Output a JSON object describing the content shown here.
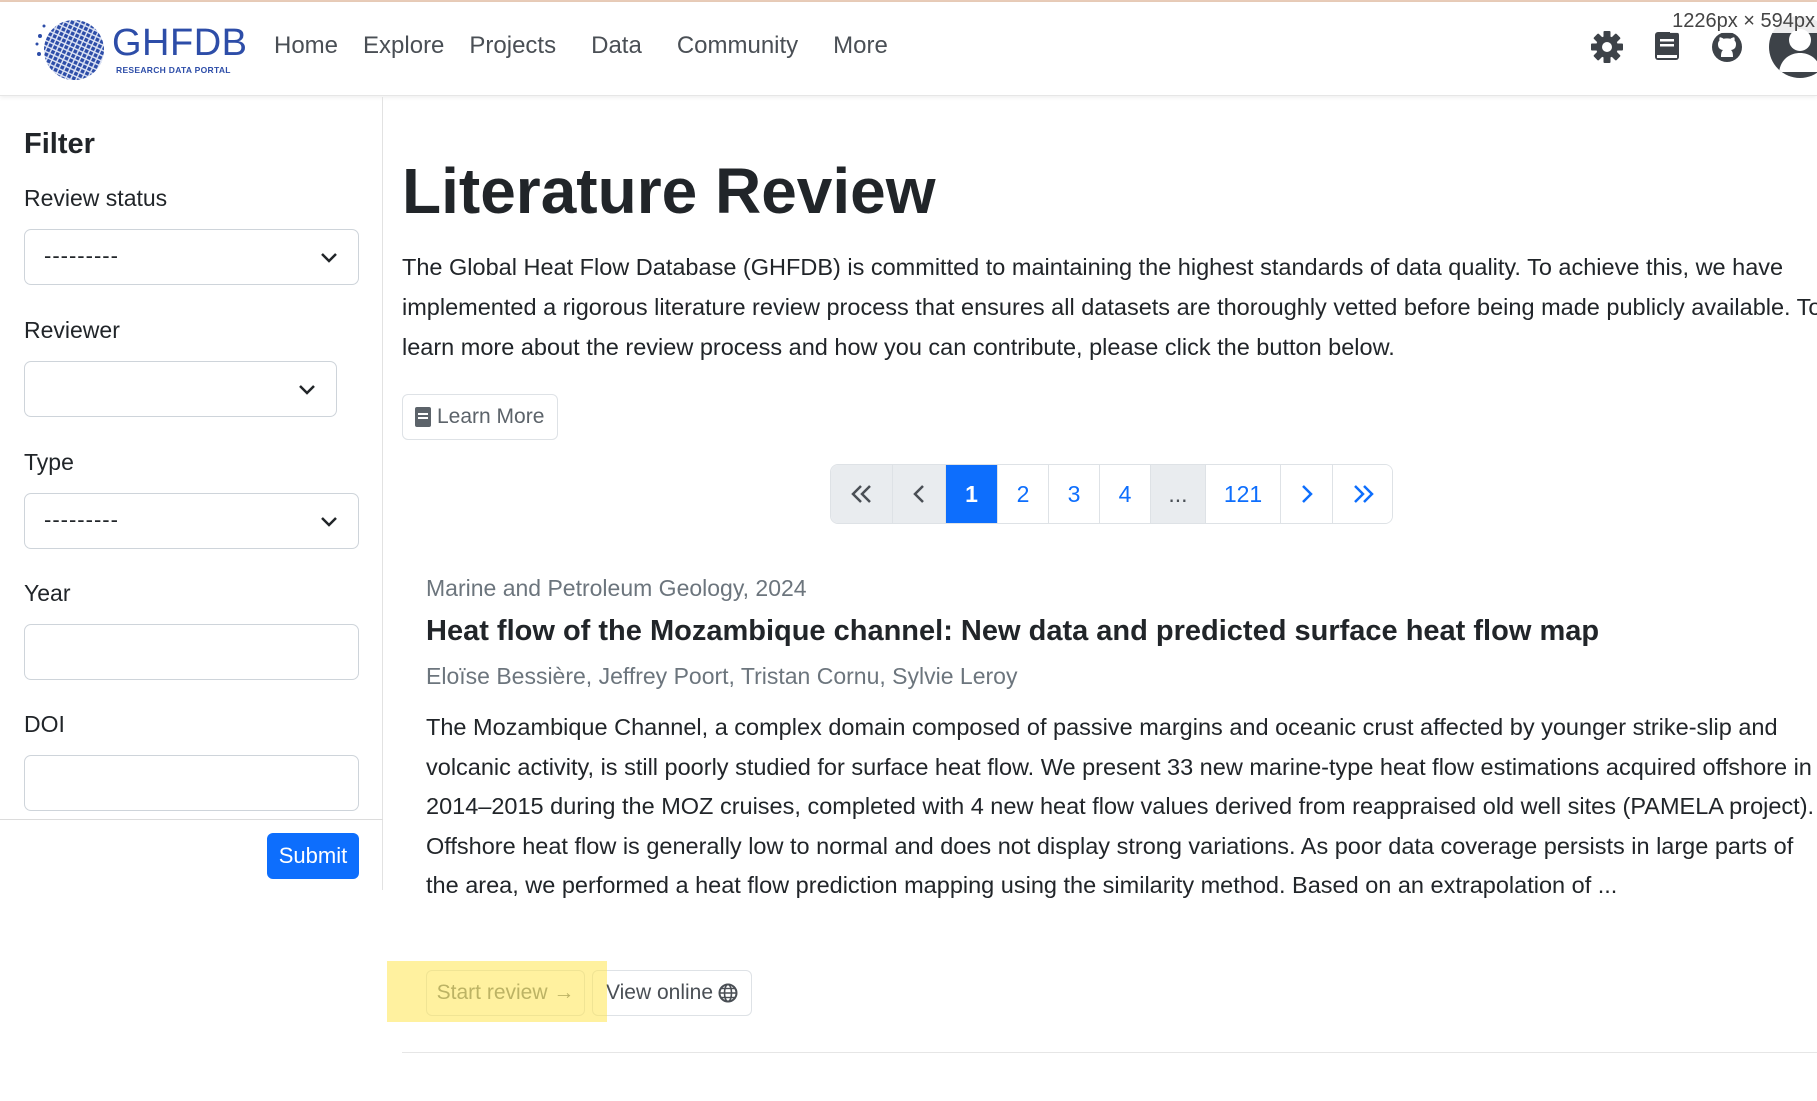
{
  "window": {
    "size_readout": "1226px × 594px"
  },
  "brand": {
    "name": "GHFDB",
    "subtitle": "RESEARCH DATA PORTAL"
  },
  "nav": {
    "links": [
      "Home",
      "Explore",
      "Projects",
      "Data",
      "Community",
      "More"
    ],
    "icons": [
      "gear-icon",
      "book-icon",
      "github-icon",
      "user-avatar-icon"
    ]
  },
  "sidebar": {
    "title": "Filter",
    "review_status": {
      "label": "Review status",
      "value": "---------"
    },
    "reviewer": {
      "label": "Reviewer",
      "value": ""
    },
    "type": {
      "label": "Type",
      "value": "---------"
    },
    "year": {
      "label": "Year",
      "value": ""
    },
    "doi": {
      "label": "DOI",
      "value": ""
    },
    "submit_label": "Submit"
  },
  "main": {
    "title": "Literature Review",
    "intro": "The Global Heat Flow Database (GHFDB) is committed to maintaining the highest standards of data quality. To achieve this, we have implemented a rigorous literature review process that ensures all datasets are thoroughly vetted before being made publicly available. To learn more about the review process and how you can contribute, please click the button below.",
    "learn_more_label": "Learn More"
  },
  "pagination": {
    "first": "«",
    "prev": "‹",
    "pages": [
      "1",
      "2",
      "3",
      "4"
    ],
    "ellipsis": "...",
    "last_page": "121",
    "next": "›",
    "last": "»",
    "active_page": "1"
  },
  "article": {
    "journal": "Marine and Petroleum Geology, 2024",
    "title": "Heat flow of the Mozambique channel: New data and predicted surface heat flow map",
    "authors": "Eloïse Bessière, Jeffrey Poort, Tristan Cornu, Sylvie Leroy",
    "abstract": "The Mozambique Channel, a complex domain composed of passive margins and oceanic crust affected by younger strike-slip and volcanic activity, is still poorly studied for surface heat flow. We present 33 new marine-type heat flow estimations acquired offshore in 2014–2015 during the MOZ cruises, completed with 4 new heat flow values derived from reappraised old well sites (PAMELA project). Offshore heat flow is generally low to normal and does not display strong variations. As poor data coverage persists in large parts of the area, we performed a heat flow prediction mapping using the similarity method. Based on an extrapolation of ...",
    "start_review_label": "Start review →",
    "view_online_label": "View online"
  },
  "colors": {
    "primary": "#0d6efd",
    "brand": "#2d4da8",
    "highlight": "#ffe650"
  }
}
